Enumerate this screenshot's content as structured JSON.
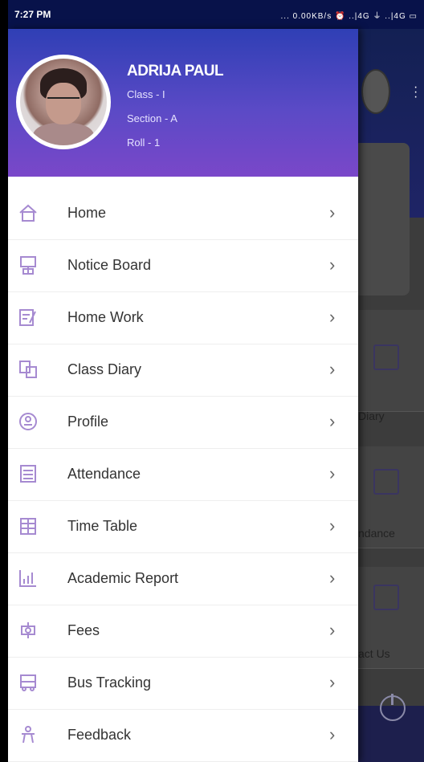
{
  "status_bar": {
    "time": "7:27 PM",
    "indicators": "... 0.00KB/s ⏰ ..|4G ⏚ ..|4G ▭"
  },
  "background": {
    "tile_labels": [
      "Diary",
      "ndance",
      "act Us"
    ]
  },
  "profile": {
    "name": "ADRIJA PAUL",
    "class": "Class - I",
    "section": "Section - A",
    "roll": "Roll - 1"
  },
  "menu": [
    {
      "label": "Home",
      "icon": "home-icon"
    },
    {
      "label": "Notice Board",
      "icon": "notice-board-icon"
    },
    {
      "label": "Home Work",
      "icon": "homework-icon"
    },
    {
      "label": "Class Diary",
      "icon": "class-diary-icon"
    },
    {
      "label": "Profile",
      "icon": "profile-icon"
    },
    {
      "label": "Attendance",
      "icon": "attendance-icon"
    },
    {
      "label": "Time Table",
      "icon": "timetable-icon"
    },
    {
      "label": "Academic Report",
      "icon": "academic-report-icon"
    },
    {
      "label": "Fees",
      "icon": "fees-icon"
    },
    {
      "label": "Bus Tracking",
      "icon": "bus-tracking-icon"
    },
    {
      "label": "Feedback",
      "icon": "feedback-icon"
    }
  ],
  "chevron": "›",
  "colors": {
    "header_start": "#2f3fb5",
    "header_end": "#7a47c9",
    "icon": "#a68ad1"
  }
}
